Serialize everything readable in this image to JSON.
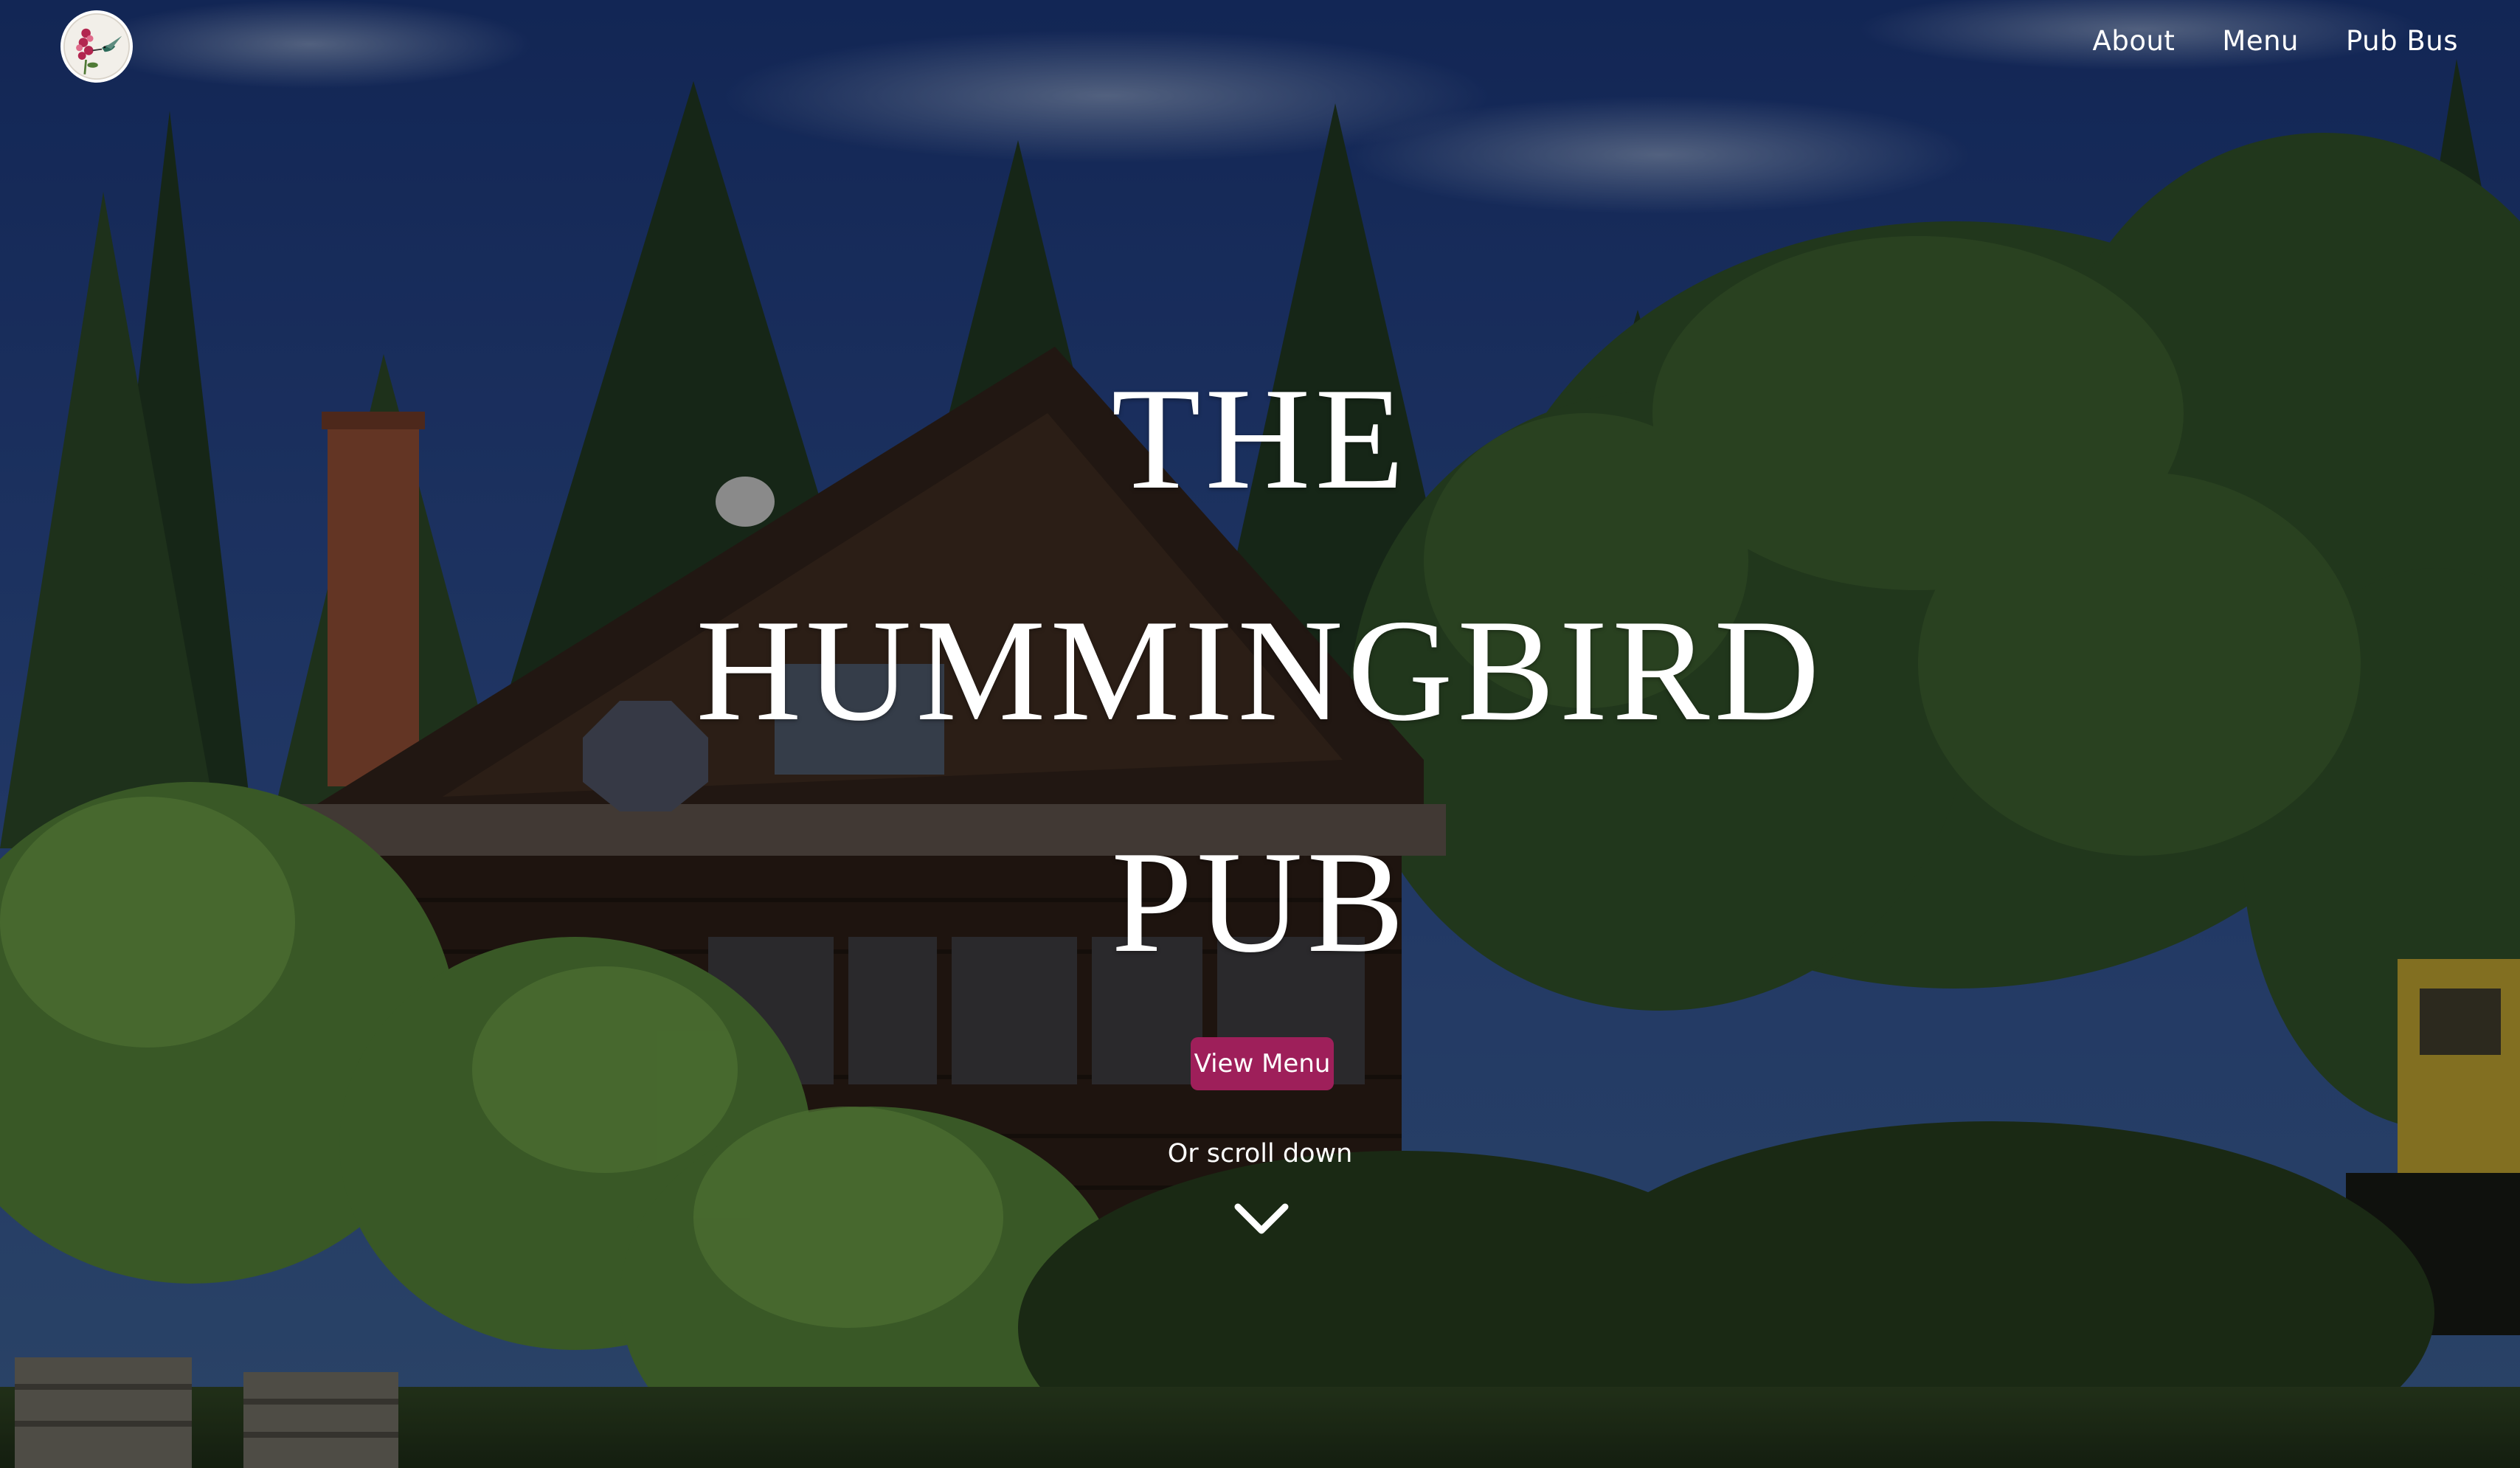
{
  "nav": {
    "logo_icon": "hummingbird-logo-icon",
    "items": [
      {
        "label": "About"
      },
      {
        "label": "Menu"
      },
      {
        "label": "Pub Bus"
      }
    ]
  },
  "hero": {
    "title_lines": [
      "THE",
      "HUMMINGBIRD",
      "PUB"
    ],
    "cta_label": "View Menu",
    "scroll_hint": "Or scroll down",
    "scroll_icon": "chevron-down-icon"
  },
  "colors": {
    "cta": "#9e1f5a",
    "text": "#ffffff",
    "sky": "#23407f",
    "foliage": "#2c4a25"
  }
}
